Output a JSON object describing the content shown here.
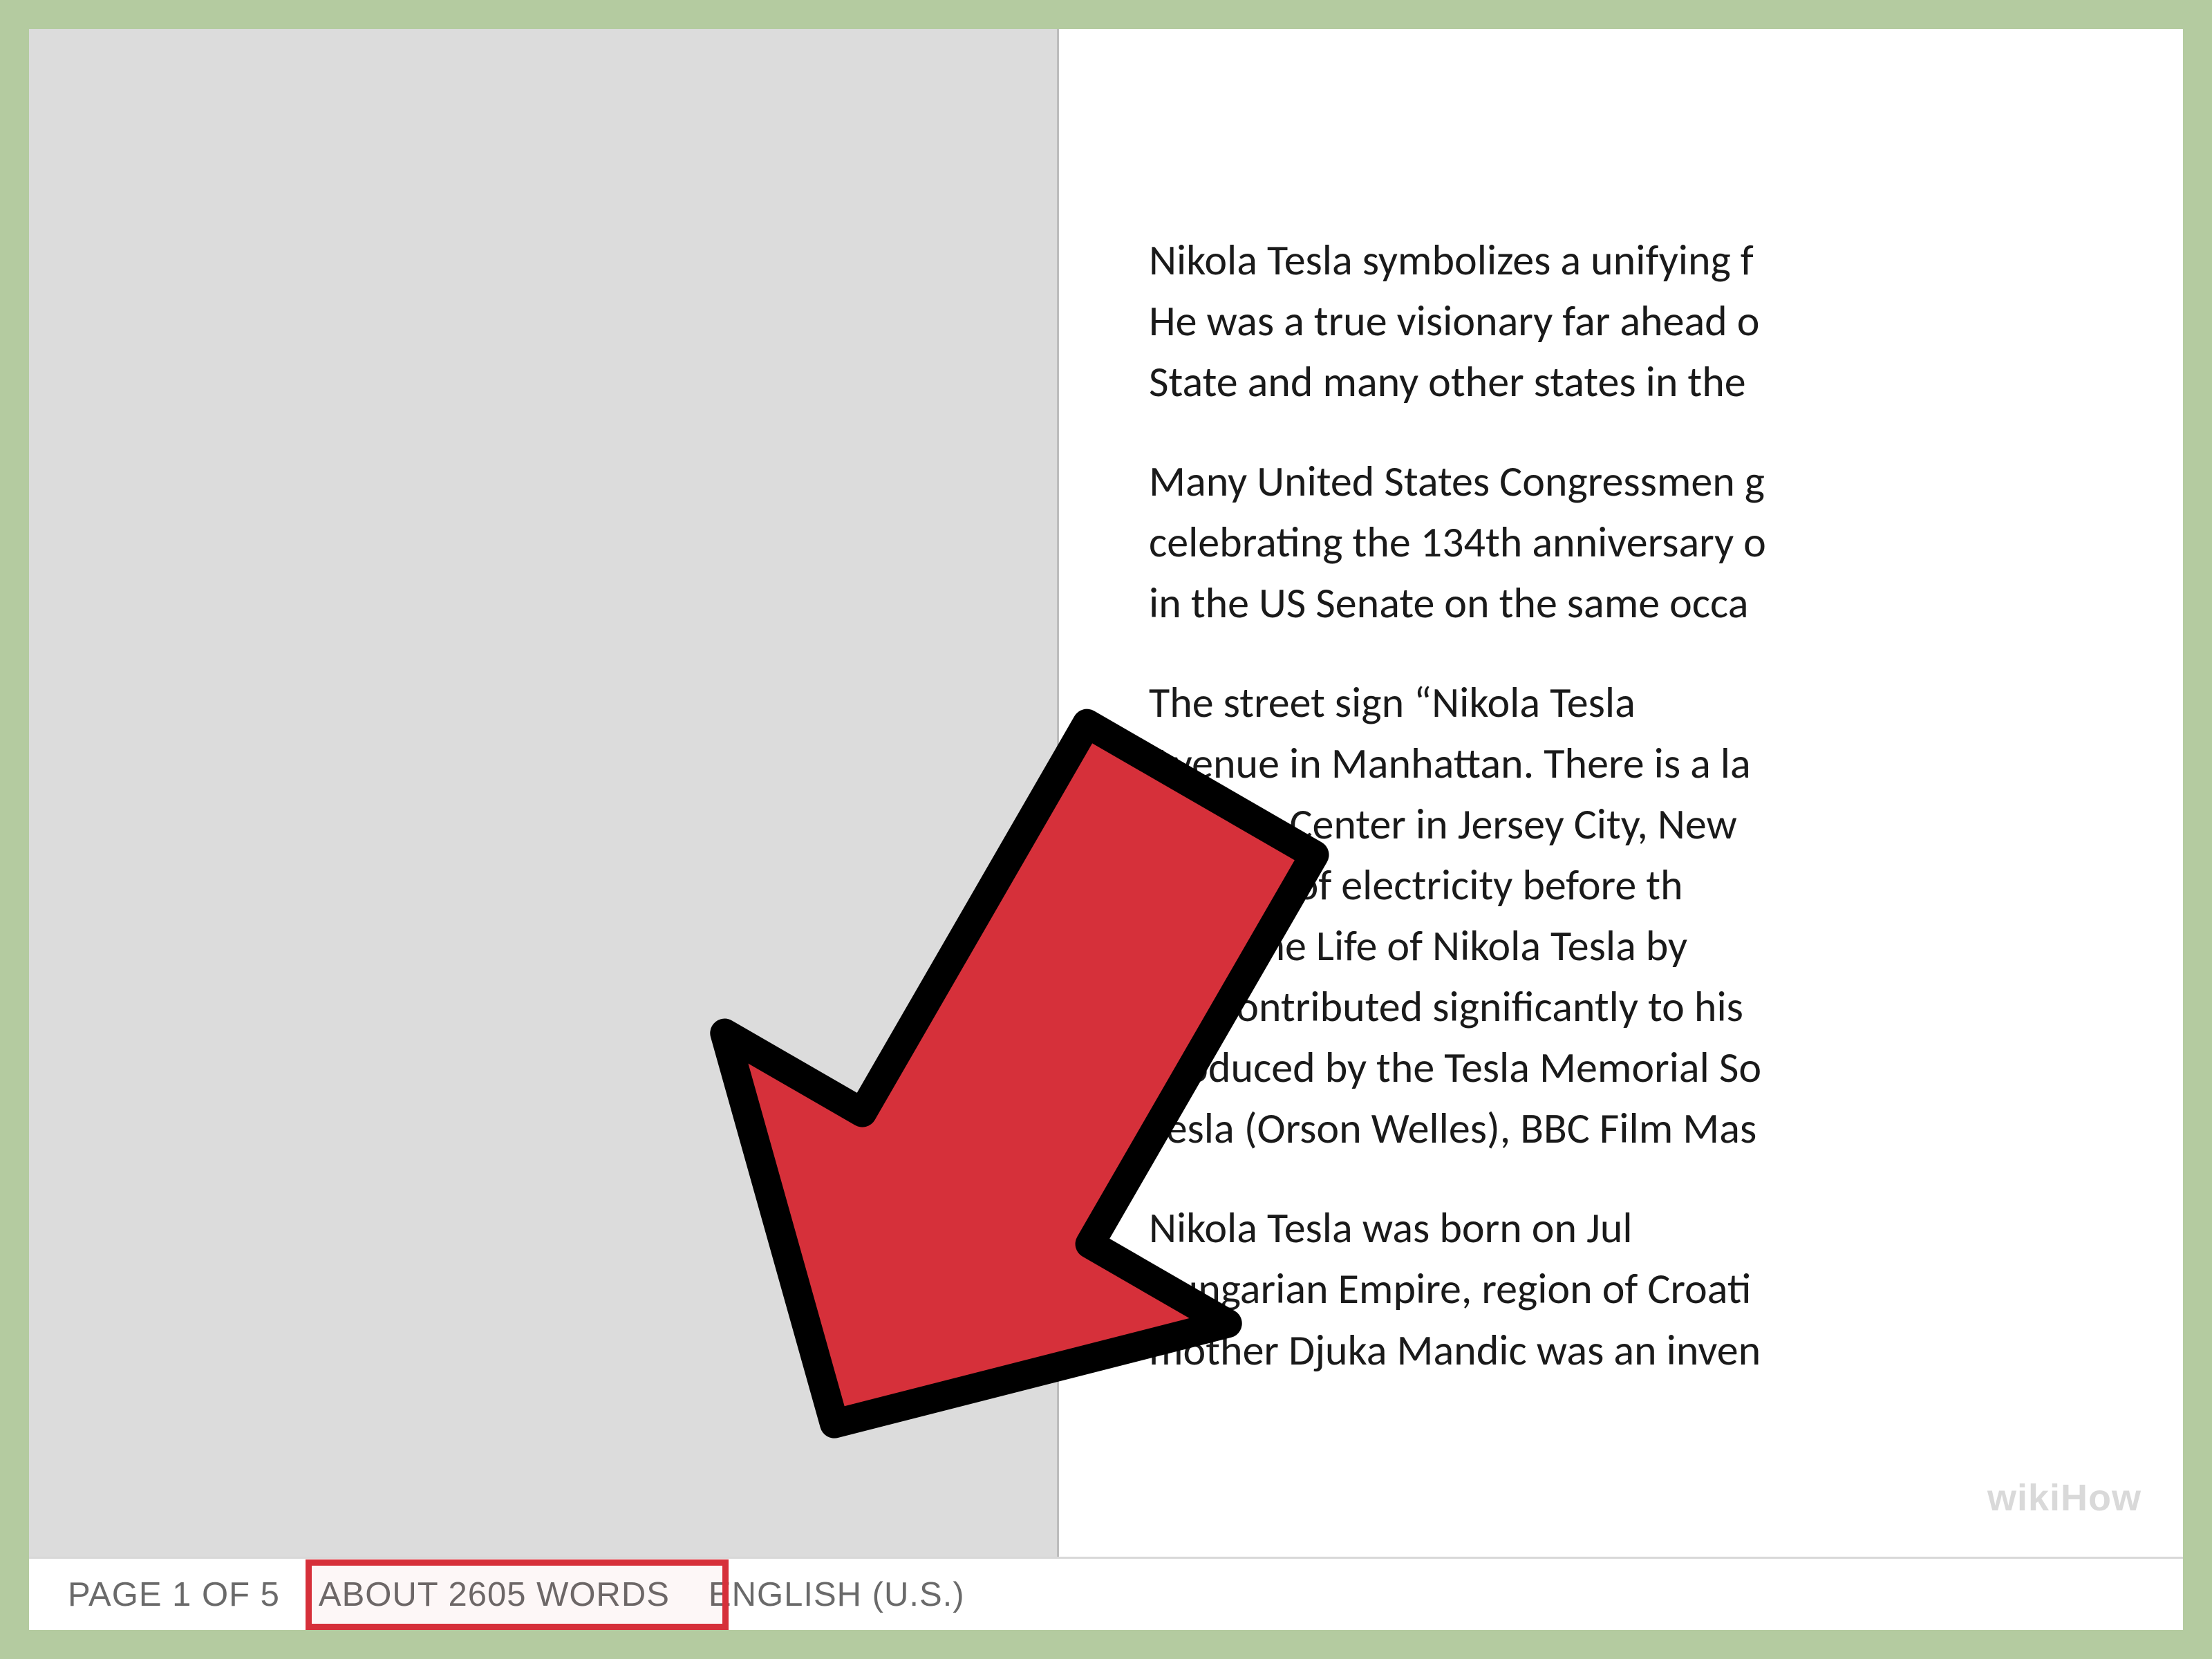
{
  "document": {
    "paragraphs": [
      "Nikola Tesla symbolizes a unifying f\nHe was a true visionary far ahead o\nState and many other states in the",
      "Many United States Congressmen g\ncelebrating the 134th anniversary o\nin the US Senate on the same occa",
      "        The street sign “Nikola Tesla\nAvenue in Manhattan. There is a la\nScience Center in Jersey City, New \non volts of electricity before th\nnius: The Life of Nikola Tesla by \nhas contributed significantly to his\nproduced by the Tesla Memorial So\nTesla (Orson Welles), BBC Film Mas",
      "        Nikola Tesla was born on Jul\nHungarian Empire, region of Croati\nmother Djuka Mandic was an inven"
    ]
  },
  "status_bar": {
    "page_indicator": "PAGE 1 OF 5",
    "word_count": "ABOUT 2605 WORDS",
    "language": "ENGLISH (U.S.)"
  },
  "annotation": {
    "arrow_color": "#d6303a",
    "highlight_target": "word_count"
  },
  "watermark": "wikiHow"
}
